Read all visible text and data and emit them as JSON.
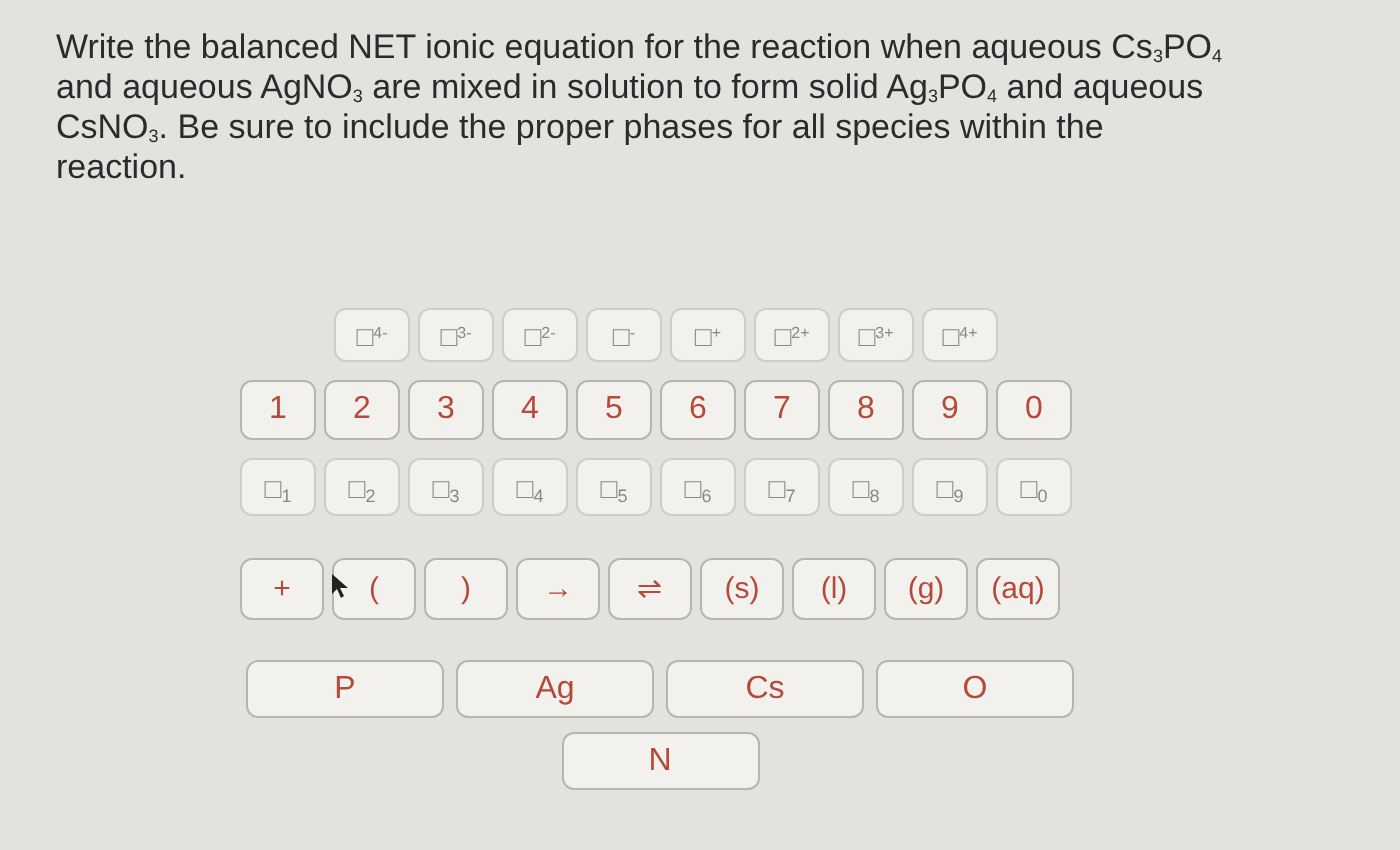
{
  "question": {
    "text": "Write the balanced NET ionic equation for the reaction when aqueous Cs$_{3}$PO$_{4}$ and aqueous AgNO$_{3}$ are mixed in solution to form solid Ag$_{3}$PO$_{4}$ and aqueous CsNO$_{3}$. Be sure to include the proper phases for all species within the reaction."
  },
  "keypad": {
    "charge_keys": [
      "□$^{4-}$",
      "□$^{3-}$",
      "□$^{2-}$",
      "□$^{-}$",
      "□$^{+}$",
      "□$^{2+}$",
      "□$^{3+}$",
      "□$^{4+}$"
    ],
    "digit_keys": [
      "1",
      "2",
      "3",
      "4",
      "5",
      "6",
      "7",
      "8",
      "9",
      "0"
    ],
    "subscript_keys": [
      "□$_{1}$",
      "□$_{2}$",
      "□$_{3}$",
      "□$_{4}$",
      "□$_{5}$",
      "□$_{6}$",
      "□$_{7}$",
      "□$_{8}$",
      "□$_{9}$",
      "□$_{0}$"
    ],
    "symbol_keys": [
      "+",
      "(",
      ")",
      "→",
      "⇌",
      "(s)",
      "(l)",
      "(g)",
      "(aq)"
    ],
    "element_keys": [
      "P",
      "Ag",
      "Cs",
      "O",
      "N"
    ]
  }
}
